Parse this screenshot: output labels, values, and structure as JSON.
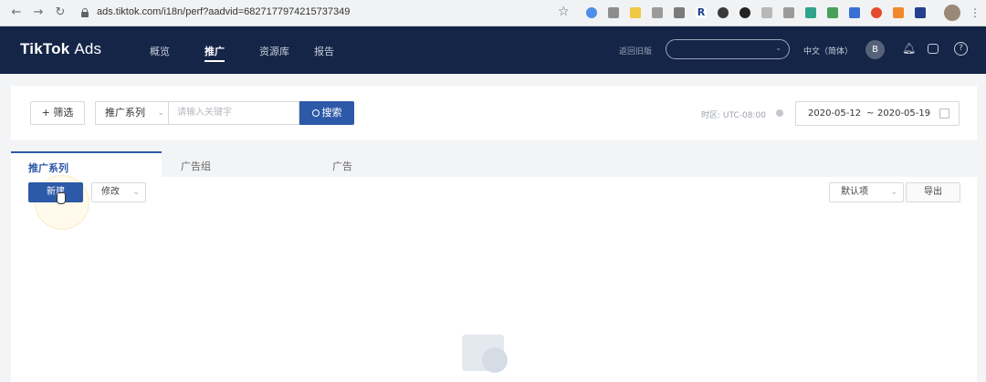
{
  "browser": {
    "url": "ads.tiktok.com/i18n/perf?aadvid=6827177974215737349"
  },
  "header": {
    "logo_brand": "TikTok",
    "logo_suffix": "Ads",
    "nav": [
      {
        "label": "概览"
      },
      {
        "label": "推广"
      },
      {
        "label": "资源库"
      },
      {
        "label": "报告"
      }
    ],
    "return_old": "返回旧版",
    "language": "中文（简体）",
    "avatar_initial": "B"
  },
  "filters": {
    "filter_button": "+ 筛选",
    "campaign_select": "推广系列",
    "search_placeholder": "请输入关键字",
    "search_button": "搜索",
    "timezone": "时区: UTC-08:00",
    "date_start": "2020-05-12",
    "date_separator": "~",
    "date_end": "2020-05-19"
  },
  "tabs": [
    {
      "label": "推广系列"
    },
    {
      "label": "广告组"
    },
    {
      "label": "广告"
    }
  ],
  "toolbar": {
    "new_button": "新建",
    "edit_button": "修改",
    "default_columns": "默认项",
    "export_button": "导出"
  },
  "colors": {
    "header_bg": "#152547",
    "primary": "#2d5aa8"
  }
}
